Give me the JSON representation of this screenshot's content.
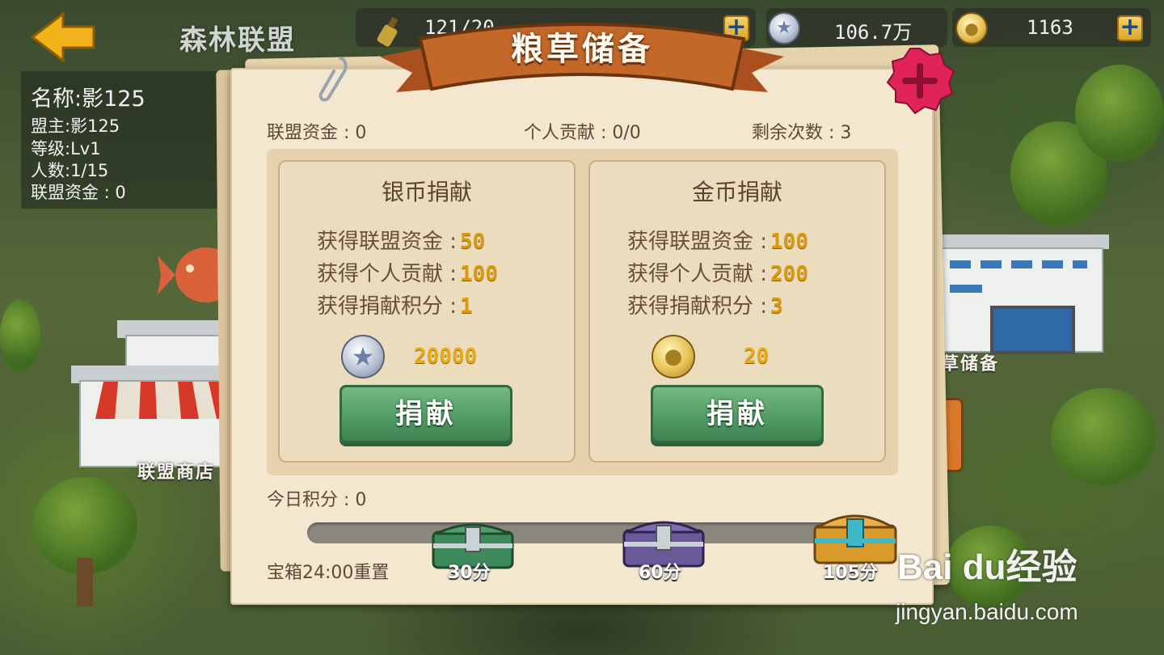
{
  "topbar": {
    "alliance_name": "森林联盟",
    "food_value": "121/20",
    "silver_value": "106.7万",
    "gold_value": "1163",
    "plus_label": "+"
  },
  "info": {
    "name": "名称:影125",
    "leader": "盟主:影125",
    "level": "等级:Lv1",
    "members": "人数:1/15",
    "funds": "联盟资金 : 0"
  },
  "dialog": {
    "title": "粮草储备",
    "alliance_funds": "联盟资金 : 0",
    "personal_contribution": "个人贡献 : 0/0",
    "remaining_times": "剩余次数 : 3",
    "cards": [
      {
        "title": "银币捐献",
        "line1_label": "获得联盟资金 :",
        "line1_value": "50",
        "line2_label": "获得个人贡献 :",
        "line2_value": "100",
        "line3_label": "获得捐献积分 :",
        "line3_value": "1",
        "cost_icon": "silver-coin-icon",
        "cost": "20000",
        "button": "捐献"
      },
      {
        "title": "金币捐献",
        "line1_label": "获得联盟资金 :",
        "line1_value": "100",
        "line2_label": "获得个人贡献 :",
        "line2_value": "200",
        "line3_label": "获得捐献积分 :",
        "line3_value": "3",
        "cost_icon": "gold-coin-icon",
        "cost": "20",
        "button": "捐献"
      }
    ],
    "today_score": "今日积分 : 0",
    "score_progress": 0,
    "reset_text": "宝箱24:00重置",
    "chests": [
      {
        "label": "30分",
        "color": "#3f8a5a"
      },
      {
        "label": "60分",
        "color": "#6b5a9a"
      },
      {
        "label": "105分",
        "color": "#d99a2a"
      }
    ]
  },
  "map_labels": {
    "store": "联盟商店",
    "reserve": "粮草储备"
  },
  "watermark": {
    "logo": "Bai du经验",
    "url": "jingyan.baidu.com"
  },
  "colors": {
    "accent_gold": "#d99a10",
    "button_green": "#4e9a62",
    "ribbon": "#c4682a",
    "close_red": "#e0245a"
  }
}
